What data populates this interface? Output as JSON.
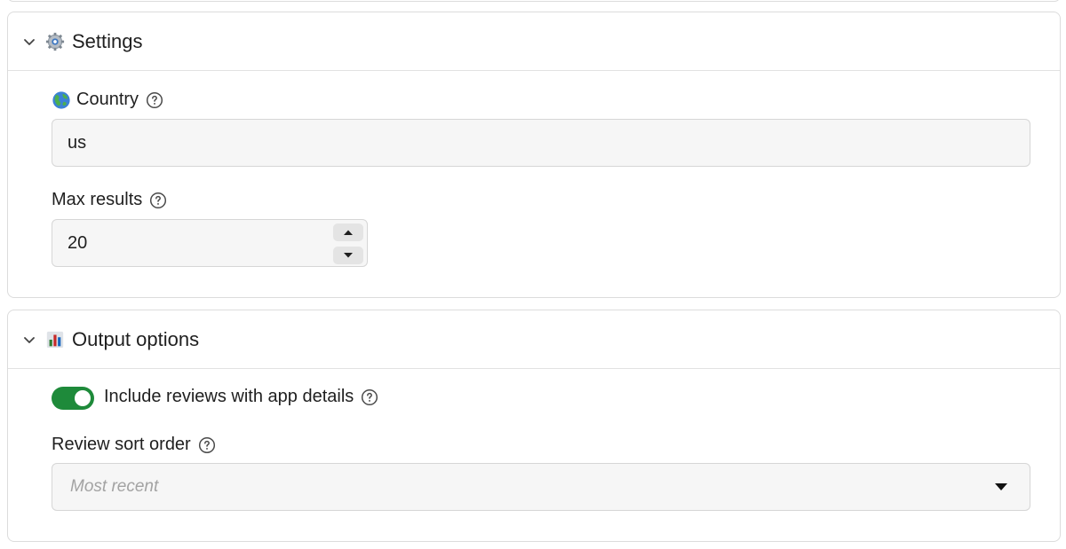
{
  "settings": {
    "title": "Settings",
    "icon": "gear-icon",
    "country": {
      "label": "Country",
      "icon": "globe-icon",
      "value": "us"
    },
    "max_results": {
      "label": "Max results",
      "value": "20"
    }
  },
  "output_options": {
    "title": "Output options",
    "icon": "bar-chart-icon",
    "include_reviews": {
      "label": "Include reviews with app details",
      "checked": true
    },
    "review_sort_order": {
      "label": "Review sort order",
      "placeholder": "Most recent"
    }
  },
  "colors": {
    "toggle_on": "#1e8a3a",
    "input_bg": "#f6f6f6",
    "border": "#dcdcdc"
  }
}
